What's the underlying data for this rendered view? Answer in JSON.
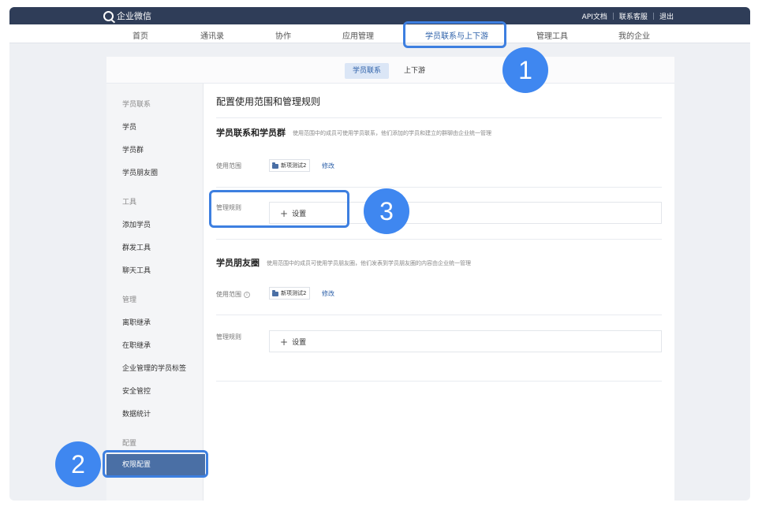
{
  "app": {
    "title": "企业微信",
    "top_links": [
      "API文档",
      "联系客服",
      "退出"
    ]
  },
  "nav": {
    "items": [
      "首页",
      "通讯录",
      "协作",
      "应用管理",
      "学员联系与上下游",
      "管理工具",
      "我的企业"
    ],
    "active": "学员联系与上下游"
  },
  "subtabs": {
    "items": [
      "学员联系",
      "上下游"
    ],
    "active": "学员联系"
  },
  "sidebar": {
    "sections": [
      {
        "title": "学员联系",
        "items": [
          "学员",
          "学员群",
          "学员朋友圈"
        ]
      },
      {
        "title": "工具",
        "items": [
          "添加学员",
          "群发工具",
          "聊天工具"
        ]
      },
      {
        "title": "管理",
        "items": [
          "离职继承",
          "在职继承",
          "企业管理的学员标签",
          "安全管控",
          "数据统计"
        ]
      },
      {
        "title": "配置",
        "items": [
          "权限配置"
        ]
      }
    ],
    "active_item": "权限配置"
  },
  "main": {
    "page_title": "配置使用范围和管理规则",
    "section1": {
      "title": "学员联系和学员群",
      "desc": "使用范围中的成员可使用学员联系，他们添加的学员和建立的群聊由企业统一管理",
      "scope_label": "使用范围",
      "scope_chip": "新项测试2",
      "edit_link": "修改",
      "rules_label": "管理规则",
      "set_button": "设置"
    },
    "section2": {
      "title": "学员朋友圈",
      "desc": "使用范围中的成员可使用学员朋友圈，他们发表到学员朋友圈的内容由企业统一管理",
      "scope_label": "使用范围",
      "scope_chip": "新项测试2",
      "edit_link": "修改",
      "rules_label": "管理规则",
      "set_button": "设置"
    }
  },
  "annotations": {
    "badge1": "1",
    "badge2": "2",
    "badge3": "3",
    "highlight_color": "#3d7fe0"
  }
}
